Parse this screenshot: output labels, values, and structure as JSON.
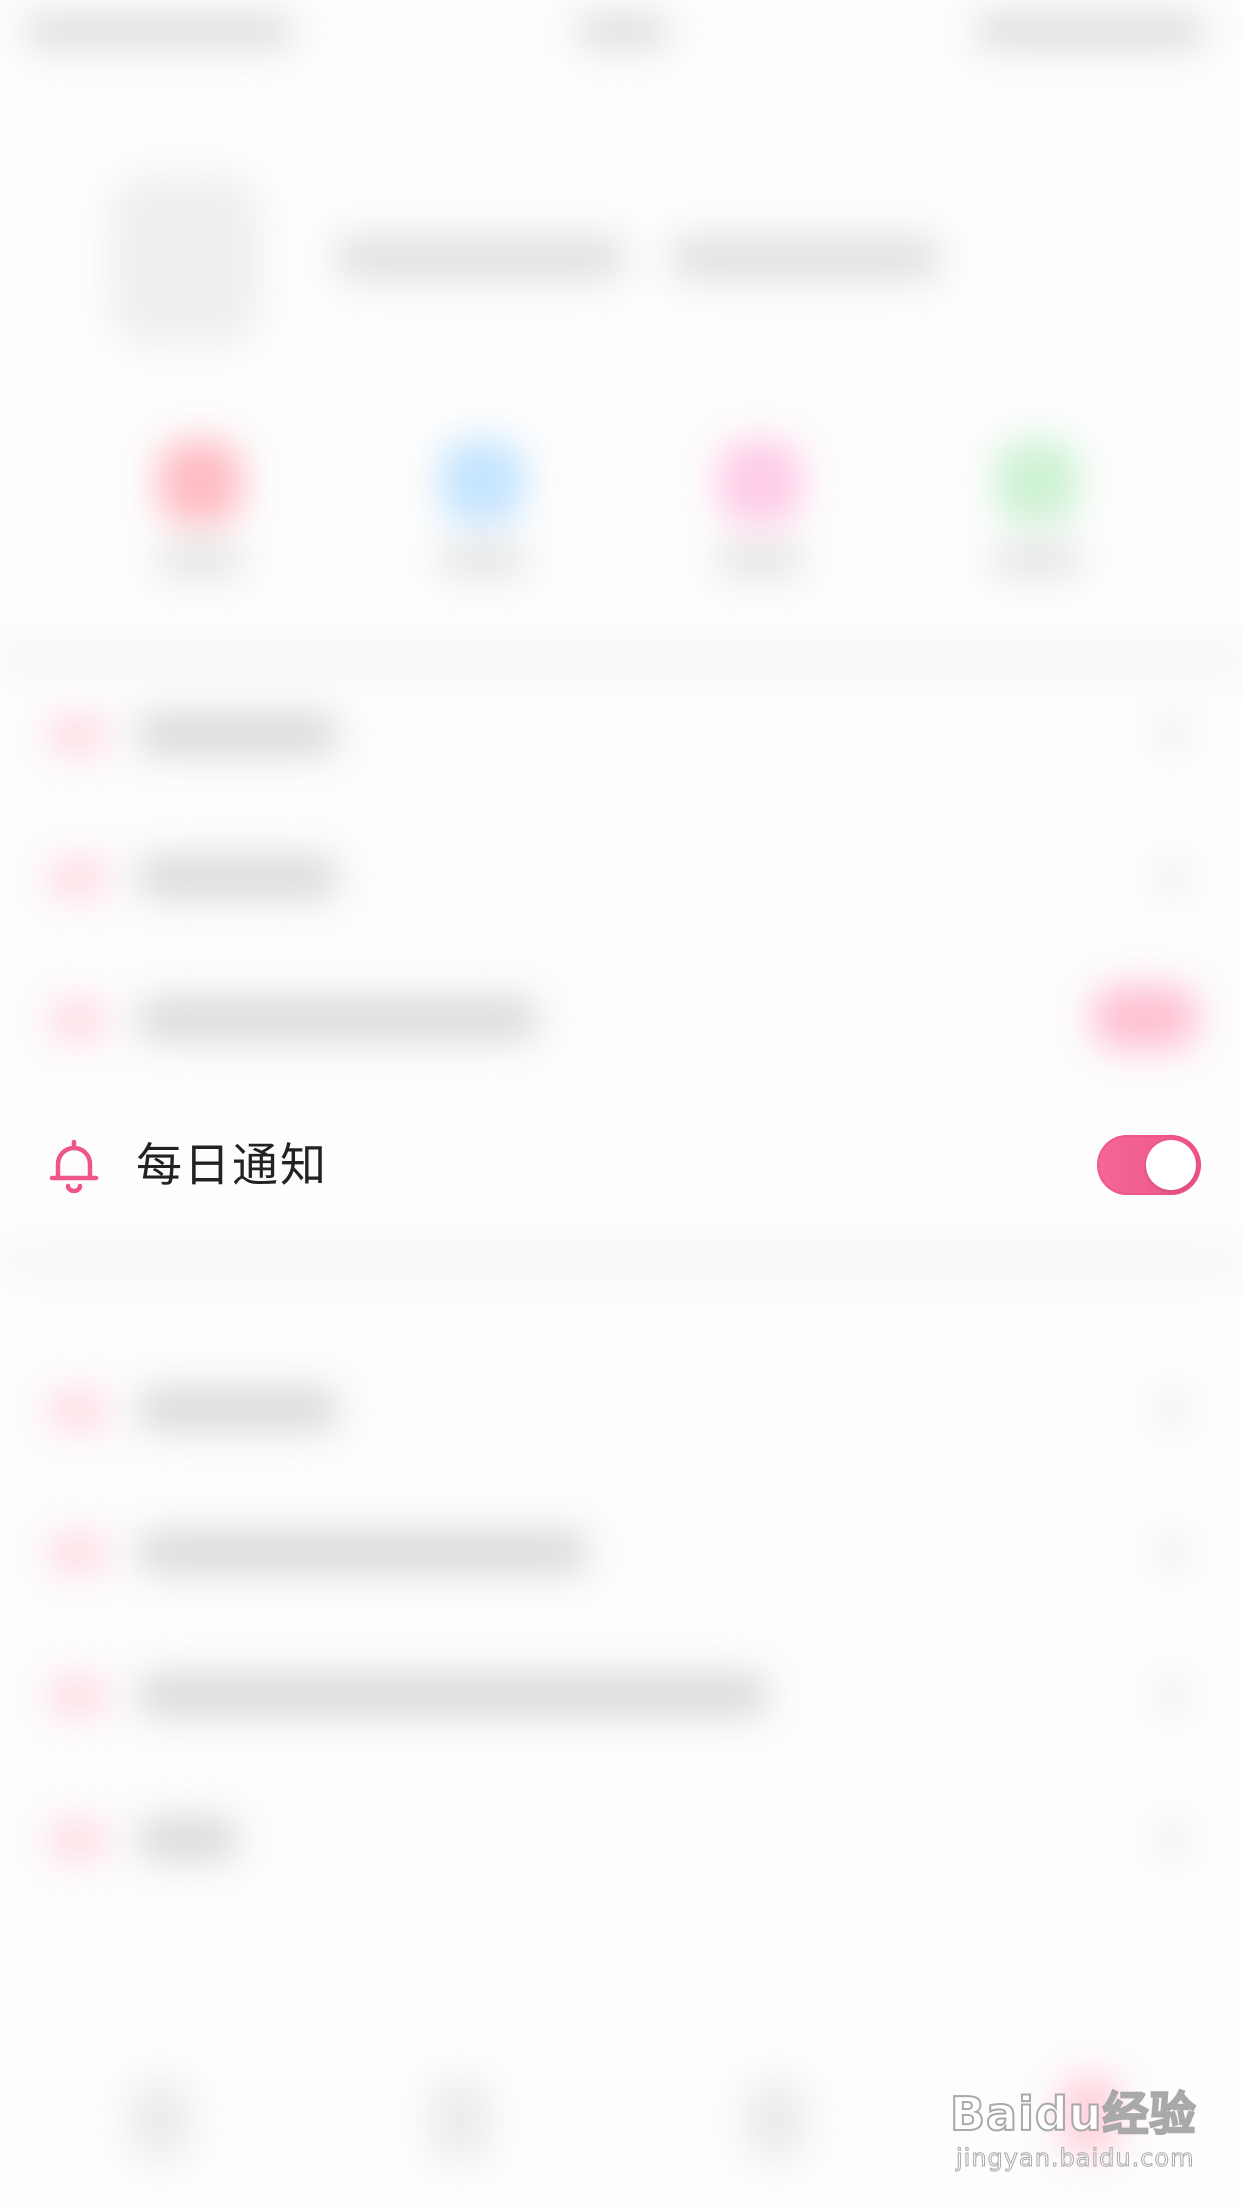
{
  "settings_row": {
    "icon": "bell-icon",
    "label": "每日通知",
    "toggle_on": true
  },
  "colors": {
    "accent": "#f05587",
    "text": "#222222",
    "background": "#fdfdfd"
  },
  "watermark": {
    "main": "Baidu经验",
    "sub": "jingyan.baidu.com"
  }
}
